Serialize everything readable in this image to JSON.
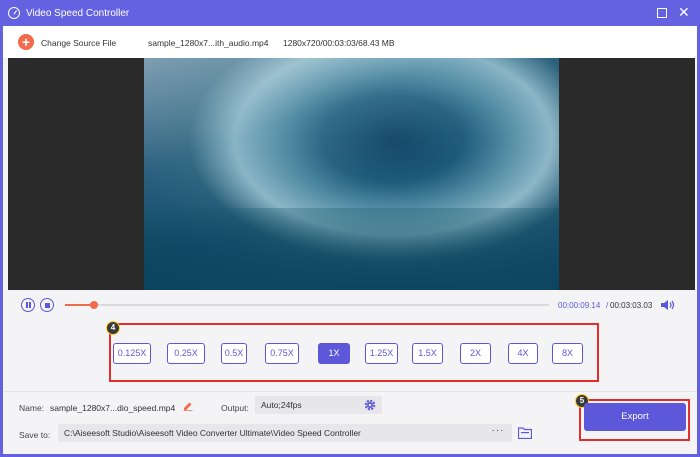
{
  "window": {
    "title": "Video Speed Controller",
    "max_glyph": "",
    "close_glyph": "✕"
  },
  "colors": {
    "accent": "#5c58d9",
    "titlebar": "#6562e2",
    "orange": "#f26a4b",
    "highlight": "#e52d2d"
  },
  "source": {
    "add_glyph": "+",
    "change_label": "Change Source File",
    "file_name": "sample_1280x7...ith_audio.mp4",
    "file_info": "1280x720/00:03:03/68.43 MB"
  },
  "player": {
    "current_time": "00:00:09.14",
    "separator": "/",
    "total_time": "00:03:03.03",
    "progress_fraction": 0.06
  },
  "speed": {
    "badge": "4",
    "options": [
      "0.125X",
      "0.25X",
      "0.5X",
      "0.75X",
      "1X",
      "1.25X",
      "1.5X",
      "2X",
      "4X",
      "8X"
    ],
    "selected": "1X"
  },
  "output_settings": {
    "name_label": "Name:",
    "name_value": "sample_1280x7...dio_speed.mp4",
    "output_label": "Output:",
    "output_value": "Auto;24fps",
    "save_label": "Save to:",
    "save_path": "C:\\Aiseesoft Studio\\Aiseesoft Video Converter Ultimate\\Video Speed Controller",
    "browse_label": "···"
  },
  "export": {
    "badge": "5",
    "label": "Export"
  },
  "icons": [
    "app-logo-icon",
    "plus-icon",
    "pause-icon",
    "stop-icon",
    "volume-icon",
    "edit-icon",
    "gear-icon",
    "folder-icon"
  ]
}
